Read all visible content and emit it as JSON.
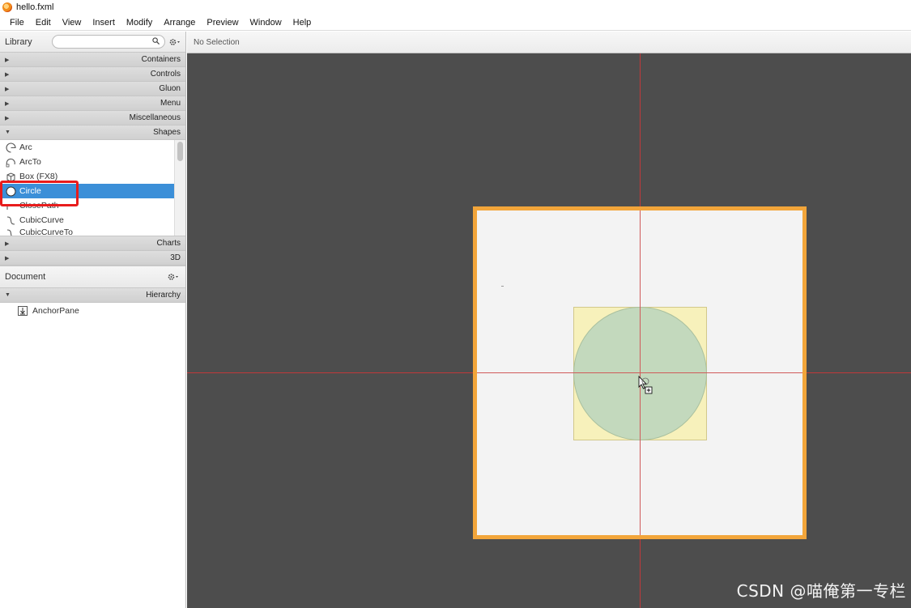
{
  "window": {
    "title": "hello.fxml"
  },
  "menu": [
    "File",
    "Edit",
    "View",
    "Insert",
    "Modify",
    "Arrange",
    "Preview",
    "Window",
    "Help"
  ],
  "library": {
    "label": "Library",
    "search_placeholder": "",
    "sections_top": [
      {
        "label": "Containers",
        "expanded": false
      },
      {
        "label": "Controls",
        "expanded": false
      },
      {
        "label": "Gluon",
        "expanded": false
      },
      {
        "label": "Menu",
        "expanded": false
      },
      {
        "label": "Miscellaneous",
        "expanded": false
      },
      {
        "label": "Shapes",
        "expanded": true
      }
    ],
    "shapes": [
      {
        "label": "Arc",
        "icon": "arc-icon"
      },
      {
        "label": "ArcTo",
        "icon": "arcto-icon"
      },
      {
        "label": "Box  (FX8)",
        "icon": "box-icon"
      },
      {
        "label": "Circle",
        "icon": "circle-icon",
        "selected": true
      },
      {
        "label": "ClosePath",
        "icon": "closepath-icon"
      },
      {
        "label": "CubicCurve",
        "icon": "cubiccurve-icon"
      },
      {
        "label": "CubicCurveTo",
        "icon": "cubiccurveto-icon"
      }
    ],
    "sections_bottom": [
      {
        "label": "Charts",
        "expanded": false
      },
      {
        "label": "3D",
        "expanded": false
      }
    ]
  },
  "document": {
    "label": "Document",
    "hierarchy_label": "Hierarchy",
    "tree": [
      {
        "label": "AnchorPane",
        "icon": "anchorpane-icon"
      }
    ]
  },
  "status": {
    "text": "No Selection"
  },
  "watermark": "CSDN @喵俺第一专栏",
  "colors": {
    "canvas_bg": "#4d4d4d",
    "pane_border": "#f2a53a",
    "selection": "#3b8fd8",
    "guide": "#c0393b",
    "circle_fill": "#c3d9bd",
    "bbox_fill": "#f7f1bb",
    "highlight": "#e81c1c"
  }
}
